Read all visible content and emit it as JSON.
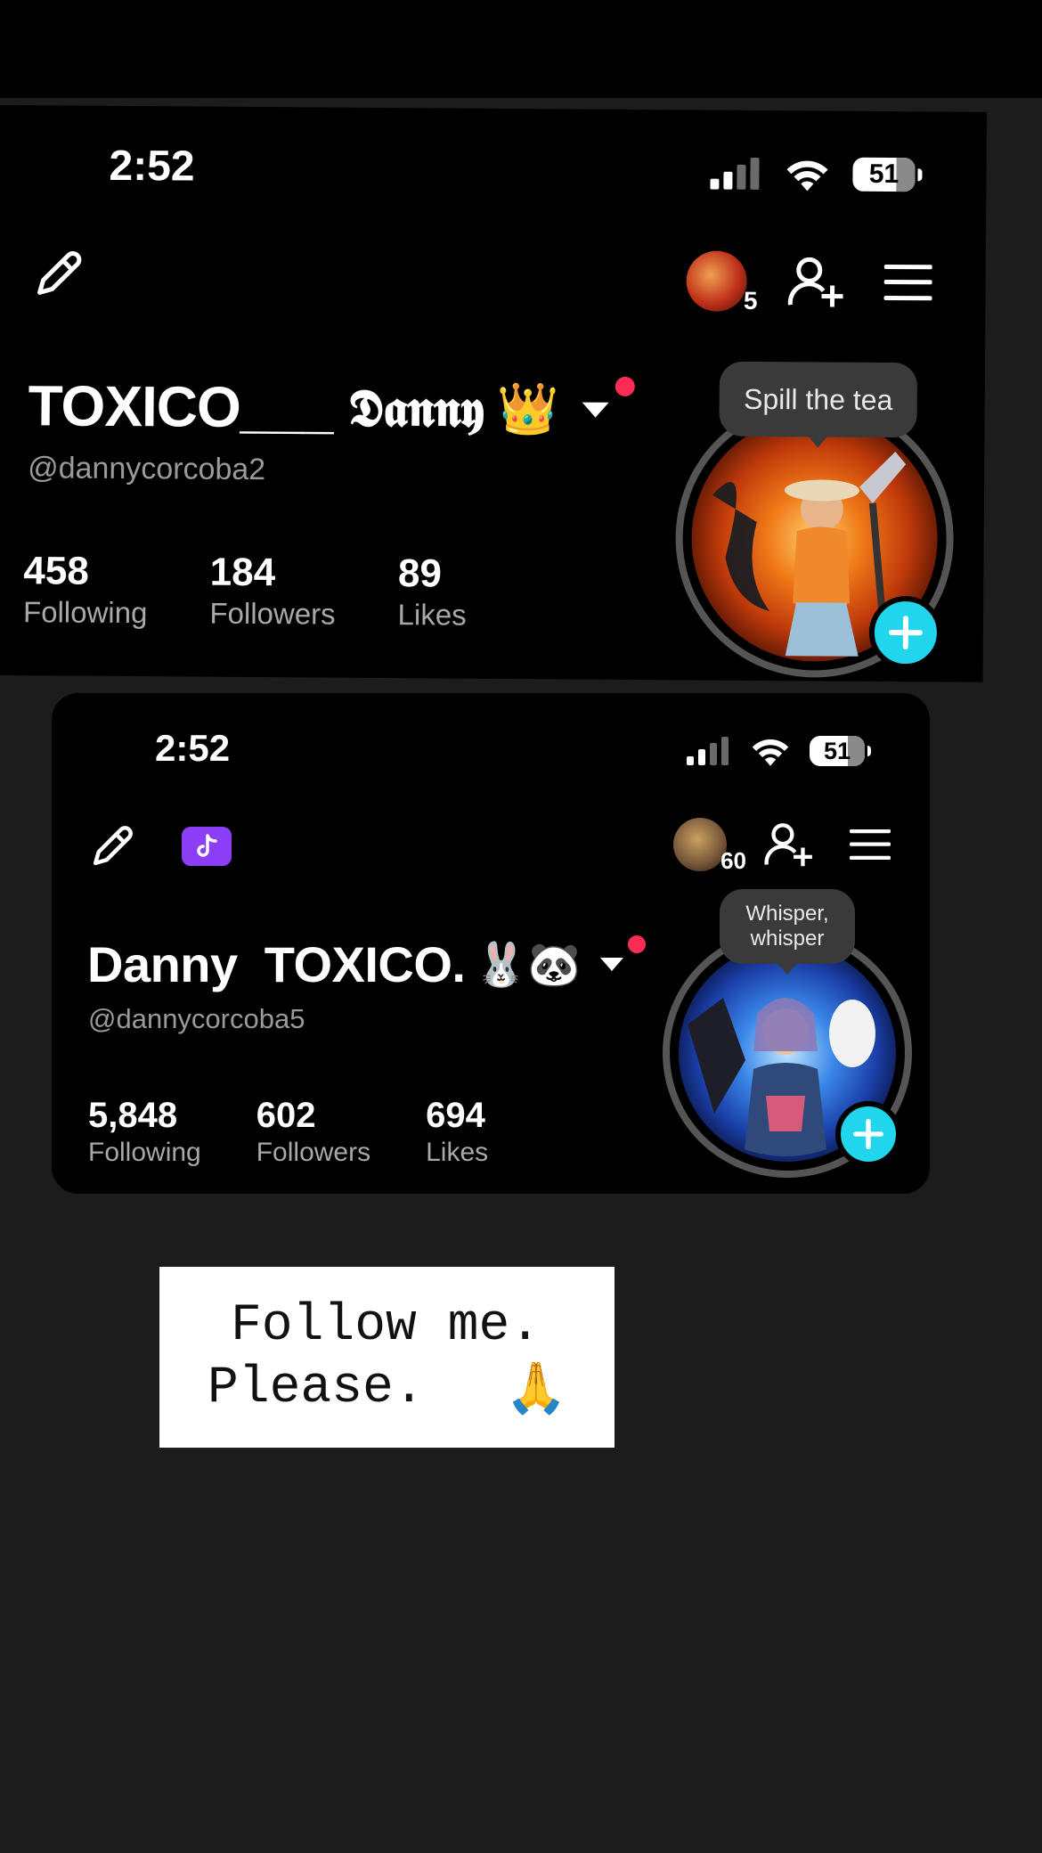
{
  "card1": {
    "time": "2:52",
    "battery": "51",
    "friends_count": "5",
    "name": "TOXICO___",
    "name_script": "𝕯𝖆𝖓𝖓𝖞",
    "crown": "👑",
    "handle": "@dannycorcoba2",
    "stats": [
      {
        "value": "458",
        "label": "Following"
      },
      {
        "value": "184",
        "label": "Followers"
      },
      {
        "value": "89",
        "label": "Likes"
      }
    ],
    "bubble": "Spill the tea"
  },
  "card2": {
    "time": "2:52",
    "battery": "51",
    "friends_count": "60",
    "name": "Danny  TOXICO.",
    "emojis": "🐰🐼",
    "handle": "@dannycorcoba5",
    "stats": [
      {
        "value": "5,848",
        "label": "Following"
      },
      {
        "value": "602",
        "label": "Followers"
      },
      {
        "value": "694",
        "label": "Likes"
      }
    ],
    "bubble_line1": "Whisper,",
    "bubble_line2": "whisper"
  },
  "note": {
    "line1": "Follow me.",
    "line2": "Please.",
    "emoji": "🙏"
  },
  "colors": {
    "accent_plus": "#20d5ec",
    "notification_dot": "#fe2c55",
    "tiktok_badge": "#8b3ef5"
  },
  "icons": [
    "pencil-icon",
    "add-friend-icon",
    "menu-icon",
    "signal-icon",
    "wifi-icon",
    "battery-icon",
    "tiktok-icon",
    "plus-icon"
  ]
}
